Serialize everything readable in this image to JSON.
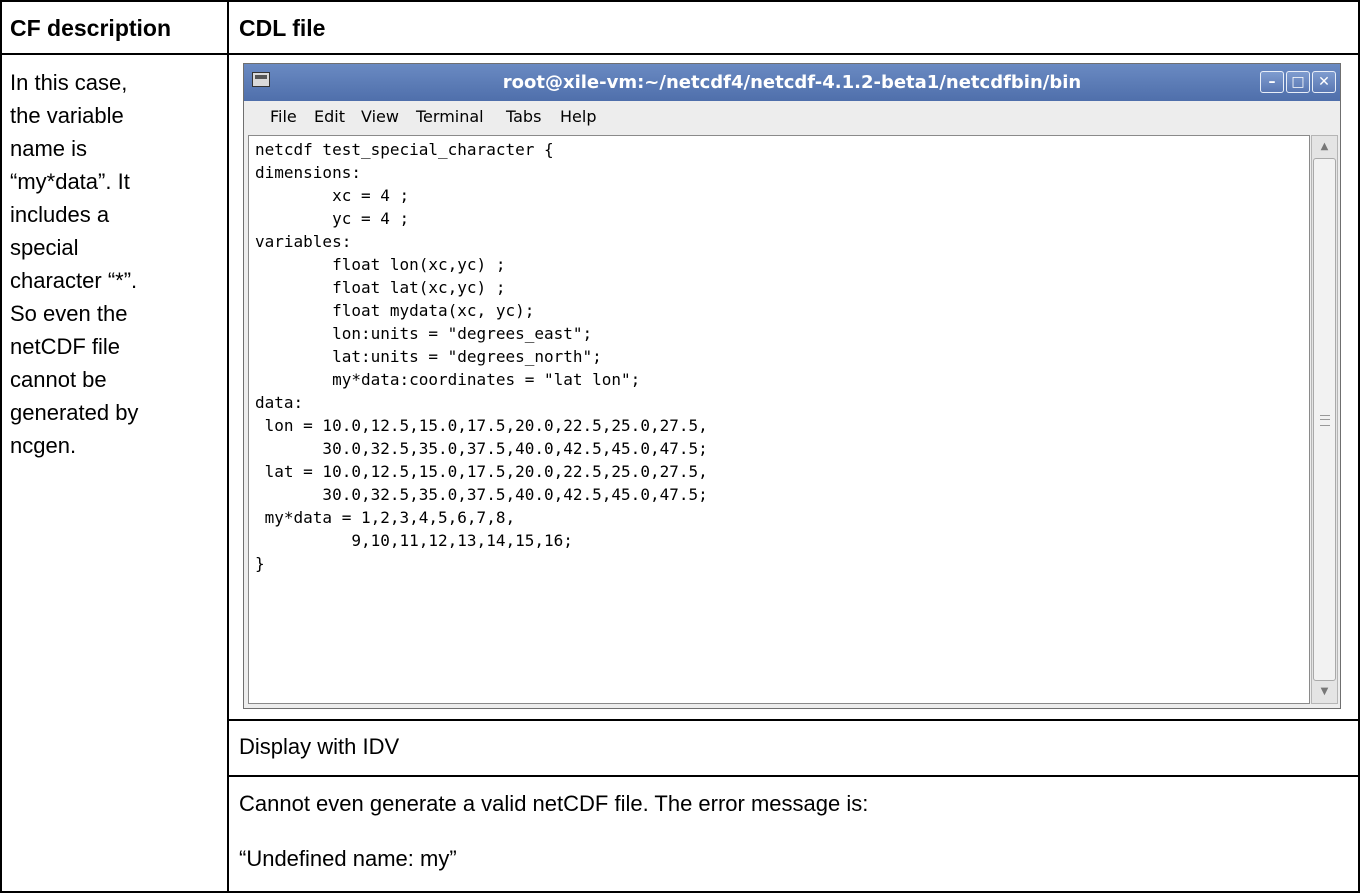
{
  "table": {
    "headers": {
      "col1": "CF description",
      "col2": "CDL file"
    },
    "description_lines": [
      "In this case,",
      "the variable",
      "name is",
      "“my*data”. It",
      "includes a",
      "special",
      "character “*”.",
      "So even the",
      "netCDF file",
      "cannot be",
      "generated by",
      "ncgen."
    ],
    "display_label": "Display with IDV",
    "result_lines": [
      "Cannot even generate a valid netCDF file. The error message is:",
      "“Undefined name: my”"
    ]
  },
  "terminal": {
    "title": "root@xile-vm:~/netcdf4/netcdf-4.1.2-beta1/netcdfbin/bin",
    "menu": [
      "File",
      "Edit",
      "View",
      "Terminal",
      "Tabs",
      "Help"
    ],
    "content": "netcdf test_special_character {\ndimensions:\n        xc = 4 ;\n        yc = 4 ;\nvariables:\n        float lon(xc,yc) ;\n        float lat(xc,yc) ;\n        float mydata(xc, yc);\n        lon:units = \"degrees_east\";\n        lat:units = \"degrees_north\";\n        my*data:coordinates = \"lat lon\";\ndata:\n lon = 10.0,12.5,15.0,17.5,20.0,22.5,25.0,27.5,\n       30.0,32.5,35.0,37.5,40.0,42.5,45.0,47.5;\n lat = 10.0,12.5,15.0,17.5,20.0,22.5,25.0,27.5,\n       30.0,32.5,35.0,37.5,40.0,42.5,45.0,47.5;\n my*data = 1,2,3,4,5,6,7,8,\n          9,10,11,12,13,14,15,16;\n}",
    "window_buttons": {
      "minimize": "–",
      "maximize": "□",
      "close": "✕"
    },
    "icon": "terminal-icon"
  },
  "colors": {
    "titlebar": "#5a7ab6",
    "table_border": "#000000"
  }
}
